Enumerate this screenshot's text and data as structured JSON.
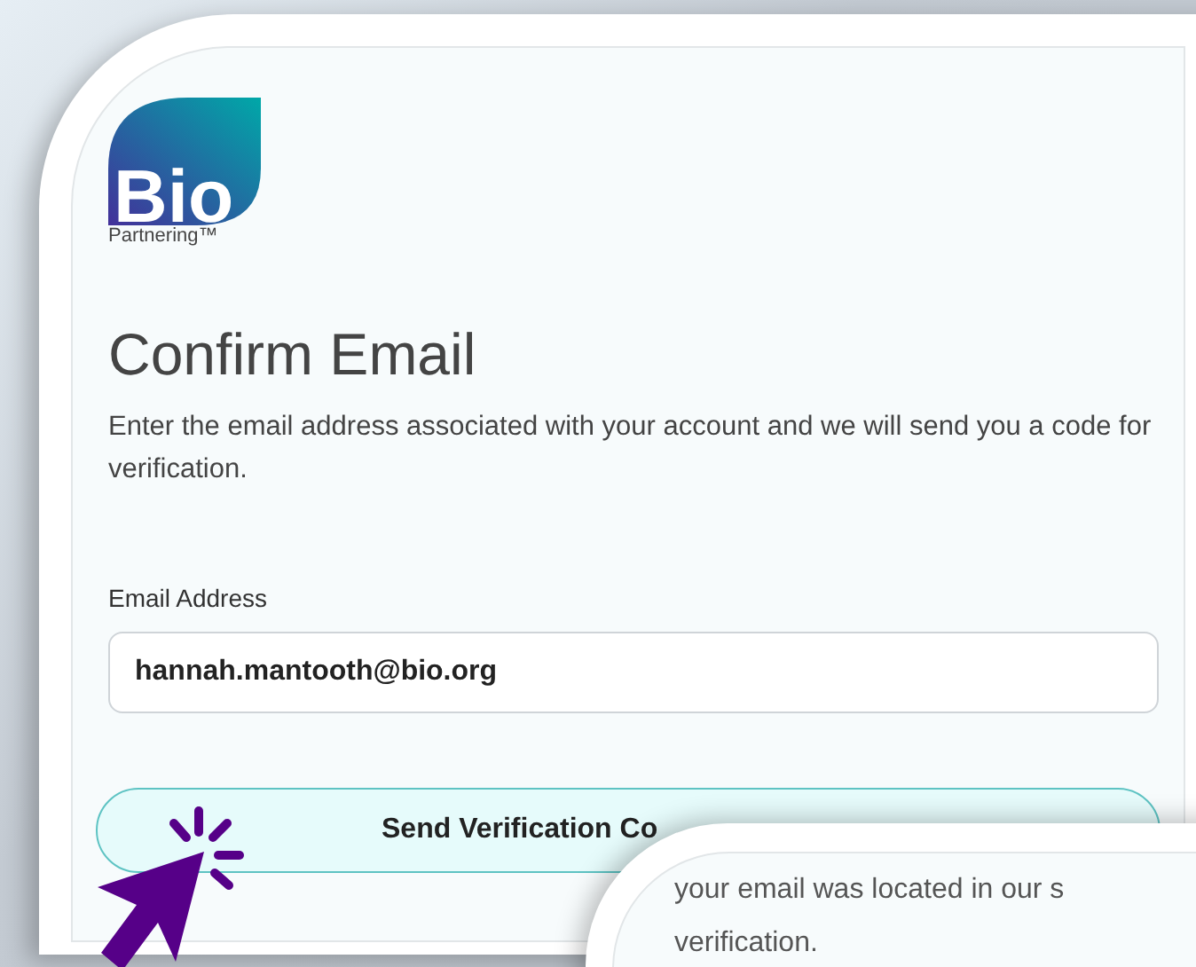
{
  "logo": {
    "wordmark": "Bio",
    "tagline": "Partnering™"
  },
  "title": "Confirm Email",
  "intro": "Enter the email address associated with your account and we will send you a code for verification.",
  "email_field": {
    "label": "Email Address",
    "value": "hannah.mantooth@bio.org"
  },
  "send_button": {
    "label": "Send Verification Co"
  },
  "overlay_card": {
    "lines": [
      "your email was located in our s",
      "verification."
    ]
  }
}
